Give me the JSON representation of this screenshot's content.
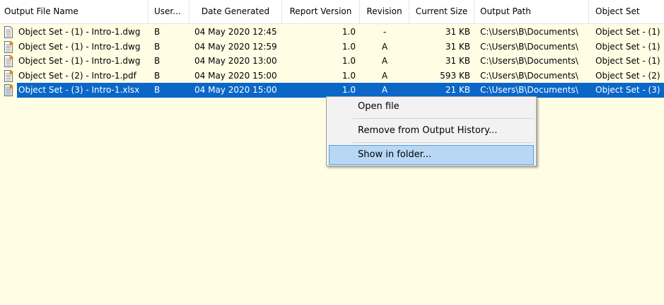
{
  "columns": [
    {
      "label": "Output File Name"
    },
    {
      "label": "User..."
    },
    {
      "label": "Date Generated"
    },
    {
      "label": "Report Version"
    },
    {
      "label": "Revision"
    },
    {
      "label": "Current Size"
    },
    {
      "label": "Output Path"
    },
    {
      "label": "Object Set"
    }
  ],
  "rows": [
    {
      "name": "Object Set - (1) - Intro-1.dwg",
      "user": "B",
      "date": "04 May 2020 12:45",
      "version": "1.0",
      "revision": "-",
      "size": "31 KB",
      "path": "C:\\Users\\B\\Documents\\",
      "objectset": "Object Set - (1)",
      "icon": "document-icon",
      "selected": false
    },
    {
      "name": "Object Set - (1) - Intro-1.dwg",
      "user": "B",
      "date": "04 May 2020 12:59",
      "version": "1.0",
      "revision": "A",
      "size": "31 KB",
      "path": "C:\\Users\\B\\Documents\\",
      "objectset": "Object Set - (1)",
      "icon": "document-new-icon",
      "selected": false
    },
    {
      "name": "Object Set - (1) - Intro-1.dwg",
      "user": "B",
      "date": "04 May 2020 13:00",
      "version": "1.0",
      "revision": "A",
      "size": "31 KB",
      "path": "C:\\Users\\B\\Documents\\",
      "objectset": "Object Set - (1)",
      "icon": "document-new-icon",
      "selected": false
    },
    {
      "name": "Object Set - (2) - Intro-1.pdf",
      "user": "B",
      "date": "04 May 2020 15:00",
      "version": "1.0",
      "revision": "A",
      "size": "593 KB",
      "path": "C:\\Users\\B\\Documents\\",
      "objectset": "Object Set - (2)",
      "icon": "document-new-icon",
      "selected": false
    },
    {
      "name": "Object Set - (3) - Intro-1.xlsx",
      "user": "B",
      "date": "04 May 2020 15:00",
      "version": "1.0",
      "revision": "A",
      "size": "21 KB",
      "path": "C:\\Users\\B\\Documents\\",
      "objectset": "Object Set - (3)",
      "icon": "document-new-icon",
      "selected": true
    }
  ],
  "context_menu": {
    "items": [
      {
        "label": "Open file"
      },
      {
        "label": "Remove from Output History..."
      },
      {
        "label": "Show in folder..."
      }
    ]
  },
  "colors": {
    "list_background": "#fffde4",
    "selection": "#0a67c8",
    "menu_highlight": "#b7d7f5"
  }
}
